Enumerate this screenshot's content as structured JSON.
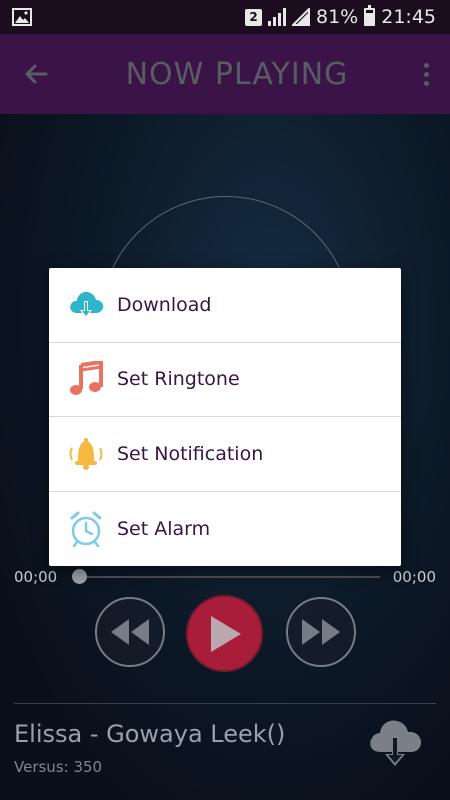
{
  "status_bar": {
    "sim": "2",
    "battery_percent": "81%",
    "time": "21:45"
  },
  "app_bar": {
    "title": "NOW PLAYING",
    "back_icon": "back-arrow-icon",
    "menu_icon": "more-vert-icon"
  },
  "dialog": {
    "items": [
      {
        "label": "Download",
        "icon": "cloud-download-icon"
      },
      {
        "label": "Set Ringtone",
        "icon": "music-note-icon"
      },
      {
        "label": "Set Notification",
        "icon": "bell-icon"
      },
      {
        "label": "Set Alarm",
        "icon": "alarm-clock-icon"
      }
    ]
  },
  "player": {
    "elapsed": "00;00",
    "duration": "00;00",
    "progress": 0,
    "song_title": "Elissa - Gowaya Leek()",
    "song_sub": "Versus: 350"
  },
  "colors": {
    "app_bar": "#3a1447",
    "status_bar": "#1b0c1e",
    "play_button": "#a71d3a",
    "dialog_text": "#3a1447"
  }
}
